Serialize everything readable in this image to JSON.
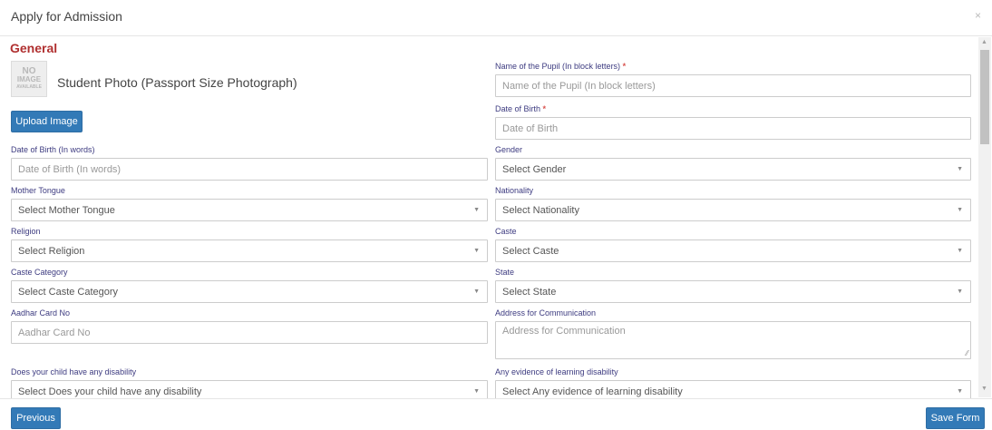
{
  "modal": {
    "title": "Apply for Admission",
    "close_glyph": "×"
  },
  "section": {
    "title": "General"
  },
  "photo": {
    "placeholder_lines": [
      "NO",
      "IMAGE",
      "AVAILABLE"
    ],
    "label": "Student Photo (Passport Size Photograph)",
    "upload_label": "Upload Image"
  },
  "required_marker": "*",
  "fields": {
    "pupil_name": {
      "label": "Name of the Pupil (In block letters)",
      "placeholder": "Name of the Pupil (In block letters)"
    },
    "dob": {
      "label": "Date of Birth",
      "placeholder": "Date of Birth"
    },
    "dob_words": {
      "label": "Date of Birth (In words)",
      "placeholder": "Date of Birth (In words)"
    },
    "gender": {
      "label": "Gender",
      "value": "Select Gender"
    },
    "mother_tongue": {
      "label": "Mother Tongue",
      "value": "Select Mother Tongue"
    },
    "nationality": {
      "label": "Nationality",
      "value": "Select Nationality"
    },
    "religion": {
      "label": "Religion",
      "value": "Select Religion"
    },
    "caste": {
      "label": "Caste",
      "value": "Select Caste"
    },
    "caste_category": {
      "label": "Caste Category",
      "value": "Select Caste Category"
    },
    "state": {
      "label": "State",
      "value": "Select State"
    },
    "aadhar": {
      "label": "Aadhar Card No",
      "placeholder": "Aadhar Card No"
    },
    "address": {
      "label": "Address for Communication",
      "placeholder": "Address for Communication"
    },
    "disability": {
      "label": "Does your child have any disability",
      "value": "Select Does your child have any disability"
    },
    "learning_disability": {
      "label": "Any evidence of learning disability",
      "value": "Select Any evidence of learning disability"
    }
  },
  "icons": {
    "caret": "chevron-down-icon",
    "resize": "resize-grip-icon",
    "scroll_up": "scroll-up-arrow-icon",
    "scroll_down": "scroll-down-arrow-icon"
  },
  "footer": {
    "previous_label": "Previous",
    "save_label": "Save Form"
  },
  "colors": {
    "primary": "#337ab7",
    "section_title": "#b03030",
    "label": "#3d3b80",
    "required": "#d9534f"
  }
}
